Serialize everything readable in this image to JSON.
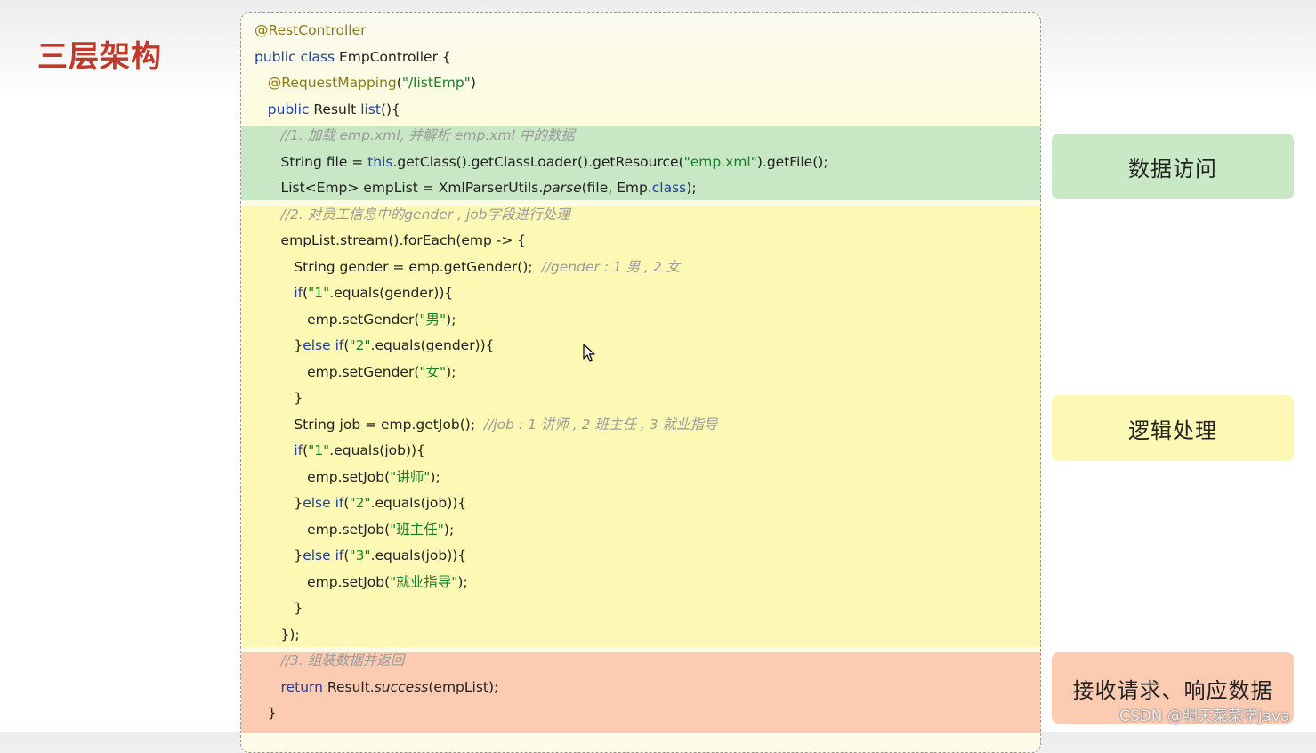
{
  "slide": {
    "title": "三层架构",
    "watermark": "CSDN @明天菜菜学java"
  },
  "code": {
    "lines": [
      [
        {
          "t": "@RestController",
          "c": "an"
        }
      ],
      [
        {
          "t": "public class ",
          "c": "kw"
        },
        {
          "t": "EmpController {",
          "c": ""
        }
      ],
      [
        {
          "t": "   @RequestMapping",
          "c": "an"
        },
        {
          "t": "(",
          "c": ""
        },
        {
          "t": "\"/listEmp\"",
          "c": "st"
        },
        {
          "t": ")",
          "c": ""
        }
      ],
      [
        {
          "t": "   public ",
          "c": "kw"
        },
        {
          "t": "Result ",
          "c": ""
        },
        {
          "t": "list",
          "c": "kw"
        },
        {
          "t": "(){",
          "c": ""
        }
      ],
      [
        {
          "t": "      //1. 加载 emp.xml, 并解析 emp.xml 中的数据",
          "c": "cm"
        }
      ],
      [
        {
          "t": "      String file = ",
          "c": ""
        },
        {
          "t": "this",
          "c": "kw"
        },
        {
          "t": ".getClass().getClassLoader().getResource(",
          "c": ""
        },
        {
          "t": "\"emp.xml\"",
          "c": "st"
        },
        {
          "t": ").getFile();",
          "c": ""
        }
      ],
      [
        {
          "t": "      List<Emp> empList = XmlParserUtils.",
          "c": ""
        },
        {
          "t": "parse",
          "c": "it"
        },
        {
          "t": "(file, Emp.",
          "c": ""
        },
        {
          "t": "class",
          "c": "kw"
        },
        {
          "t": ");",
          "c": ""
        }
      ],
      [
        {
          "t": "      //2. 对员工信息中的gender , job字段进行处理",
          "c": "cm"
        }
      ],
      [
        {
          "t": "      empList.stream().forEach(emp -> {",
          "c": ""
        }
      ],
      [
        {
          "t": "         String gender = emp.getGender();  ",
          "c": ""
        },
        {
          "t": "//gender : 1 男 , 2 女",
          "c": "cm"
        }
      ],
      [
        {
          "t": "         if",
          "c": "kw"
        },
        {
          "t": "(",
          "c": ""
        },
        {
          "t": "\"1\"",
          "c": "st"
        },
        {
          "t": ".equals(gender)){",
          "c": ""
        }
      ],
      [
        {
          "t": "            emp.setGender(",
          "c": ""
        },
        {
          "t": "\"男\"",
          "c": "st"
        },
        {
          "t": ");",
          "c": ""
        }
      ],
      [
        {
          "t": "         }",
          "c": ""
        },
        {
          "t": "else if",
          "c": "kw"
        },
        {
          "t": "(",
          "c": ""
        },
        {
          "t": "\"2\"",
          "c": "st"
        },
        {
          "t": ".equals(gender)){",
          "c": ""
        }
      ],
      [
        {
          "t": "            emp.setGender(",
          "c": ""
        },
        {
          "t": "\"女\"",
          "c": "st"
        },
        {
          "t": ");",
          "c": ""
        }
      ],
      [
        {
          "t": "         }",
          "c": ""
        }
      ],
      [
        {
          "t": "         String job = emp.getJob();  ",
          "c": ""
        },
        {
          "t": "//job : 1 讲师 , 2 班主任 , 3 就业指导",
          "c": "cm"
        }
      ],
      [
        {
          "t": "         if",
          "c": "kw"
        },
        {
          "t": "(",
          "c": ""
        },
        {
          "t": "\"1\"",
          "c": "st"
        },
        {
          "t": ".equals(job)){",
          "c": ""
        }
      ],
      [
        {
          "t": "            emp.setJob(",
          "c": ""
        },
        {
          "t": "\"讲师\"",
          "c": "st"
        },
        {
          "t": ");",
          "c": ""
        }
      ],
      [
        {
          "t": "         }",
          "c": ""
        },
        {
          "t": "else if",
          "c": "kw"
        },
        {
          "t": "(",
          "c": ""
        },
        {
          "t": "\"2\"",
          "c": "st"
        },
        {
          "t": ".equals(job)){",
          "c": ""
        }
      ],
      [
        {
          "t": "            emp.setJob(",
          "c": ""
        },
        {
          "t": "\"班主任\"",
          "c": "st"
        },
        {
          "t": ");",
          "c": ""
        }
      ],
      [
        {
          "t": "         }",
          "c": ""
        },
        {
          "t": "else if",
          "c": "kw"
        },
        {
          "t": "(",
          "c": ""
        },
        {
          "t": "\"3\"",
          "c": "st"
        },
        {
          "t": ".equals(job)){",
          "c": ""
        }
      ],
      [
        {
          "t": "            emp.setJob(",
          "c": ""
        },
        {
          "t": "\"就业指导\"",
          "c": "st"
        },
        {
          "t": ");",
          "c": ""
        }
      ],
      [
        {
          "t": "         }",
          "c": ""
        }
      ],
      [
        {
          "t": "      });",
          "c": ""
        }
      ],
      [
        {
          "t": "      //3. 组装数据并返回",
          "c": "cm"
        }
      ],
      [
        {
          "t": "      return ",
          "c": "kw"
        },
        {
          "t": "Result.",
          "c": ""
        },
        {
          "t": "success",
          "c": "it"
        },
        {
          "t": "(empList);",
          "c": ""
        }
      ],
      [
        {
          "t": "   }",
          "c": ""
        }
      ]
    ]
  },
  "layers": {
    "data_access": "数据访问",
    "logic": "逻辑处理",
    "request_response": "接收请求、响应数据"
  },
  "colors": {
    "title": "#c0392b",
    "data_band": "#c8e7c4",
    "logic_band": "#fdf8b4",
    "response_band": "#fccbb2"
  }
}
